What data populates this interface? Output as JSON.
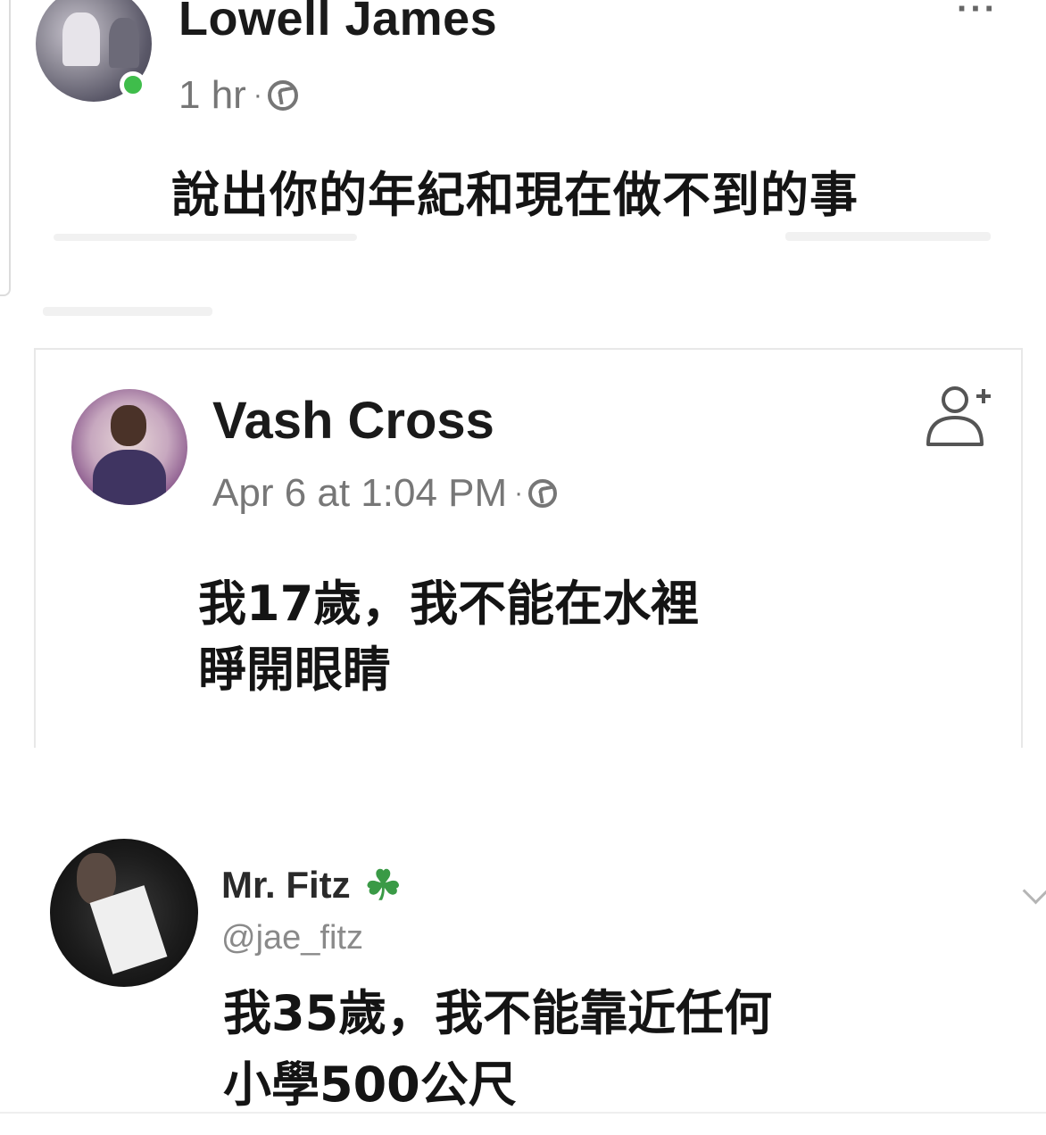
{
  "post1": {
    "author": "Lowell James",
    "time": "1 hr",
    "separator": "·",
    "text": "說出你的年紀和現在做不到的事",
    "more_label": "···",
    "online": true
  },
  "post2": {
    "author": "Vash Cross",
    "time": "Apr 6 at 1:04 PM",
    "separator": "·",
    "text_lines": [
      "我17歲，我不能在水裡",
      "睜開眼睛"
    ]
  },
  "post3": {
    "author": "Mr. Fitz",
    "handle": "@jae_fitz",
    "badge": "☘",
    "text_lines": [
      "我35歲，我不能靠近任何",
      "小學500公尺"
    ]
  },
  "icons": {
    "privacy": "globe-icon",
    "add_friend": "add-friend-icon",
    "more": "more-icon",
    "badge": "clover-icon",
    "expand": "chevron-down-icon"
  },
  "colors": {
    "online": "#3fbd4b",
    "meta_text": "#767676",
    "badge": "#3a9a46"
  }
}
